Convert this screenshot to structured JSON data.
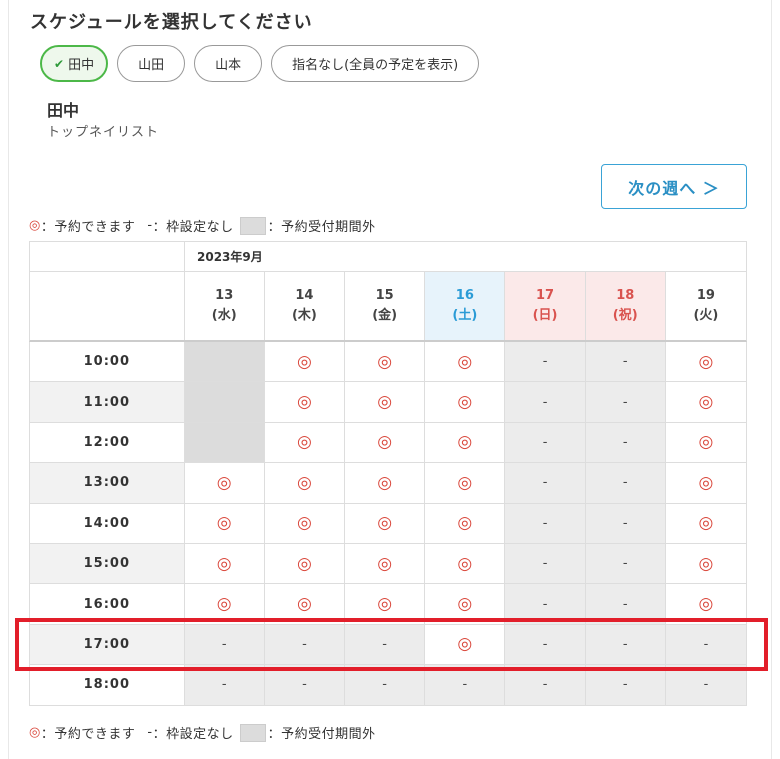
{
  "page_title": "スケジュールを選択してください",
  "staff_tabs": [
    {
      "label": "田中",
      "selected": true
    },
    {
      "label": "山田",
      "selected": false
    },
    {
      "label": "山本",
      "selected": false
    },
    {
      "label": "指名なし(全員の予定を表示)",
      "selected": false
    }
  ],
  "selected_staff": {
    "name": "田中",
    "role": "トップネイリスト"
  },
  "next_week_label": "次の週へ ＞",
  "legend": {
    "available_mark": "◎",
    "available_text": "：予約できます",
    "none_mark": "-",
    "none_text": "：枠設定なし",
    "outside_text": "：予約受付期間外"
  },
  "calendar": {
    "month_label": "2023年9月",
    "days": [
      {
        "date": "13",
        "weekday": "(水)",
        "type": "weekday"
      },
      {
        "date": "14",
        "weekday": "(木)",
        "type": "weekday"
      },
      {
        "date": "15",
        "weekday": "(金)",
        "type": "weekday"
      },
      {
        "date": "16",
        "weekday": "(土)",
        "type": "saturday"
      },
      {
        "date": "17",
        "weekday": "(日)",
        "type": "holiday"
      },
      {
        "date": "18",
        "weekday": "(祝)",
        "type": "holiday"
      },
      {
        "date": "19",
        "weekday": "(火)",
        "type": "weekday"
      }
    ],
    "rows": [
      {
        "time": "10:00",
        "slots": [
          "out",
          "avail",
          "avail",
          "avail",
          "off",
          "off",
          "avail"
        ]
      },
      {
        "time": "11:00",
        "slots": [
          "out",
          "avail",
          "avail",
          "avail",
          "off",
          "off",
          "avail"
        ]
      },
      {
        "time": "12:00",
        "slots": [
          "out",
          "avail",
          "avail",
          "avail",
          "off",
          "off",
          "avail"
        ]
      },
      {
        "time": "13:00",
        "slots": [
          "avail",
          "avail",
          "avail",
          "avail",
          "off",
          "off",
          "avail"
        ]
      },
      {
        "time": "14:00",
        "slots": [
          "avail",
          "avail",
          "avail",
          "avail",
          "off",
          "off",
          "avail"
        ]
      },
      {
        "time": "15:00",
        "slots": [
          "avail",
          "avail",
          "avail",
          "avail",
          "off",
          "off",
          "avail"
        ]
      },
      {
        "time": "16:00",
        "slots": [
          "avail",
          "avail",
          "avail",
          "avail",
          "off",
          "off",
          "avail"
        ]
      },
      {
        "time": "17:00",
        "slots": [
          "off",
          "off",
          "off",
          "avail",
          "off",
          "off",
          "off"
        ]
      },
      {
        "time": "18:00",
        "slots": [
          "off",
          "off",
          "off",
          "off",
          "off",
          "off",
          "off"
        ]
      }
    ]
  },
  "colors": {
    "available": "#d9463a",
    "saturday": "#2a9bd6",
    "holiday": "#d9534f",
    "selected_tab_border": "#4cb848",
    "highlight": "#e21e2a"
  },
  "icons": {
    "selected_tab": "check-icon"
  }
}
